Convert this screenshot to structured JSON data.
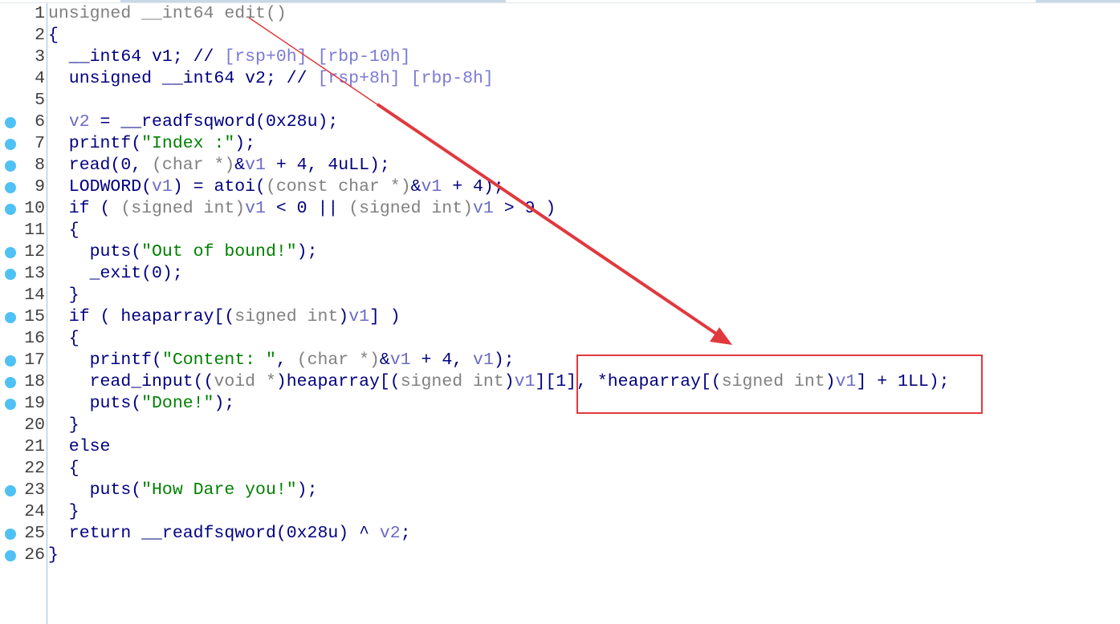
{
  "colors": {
    "code": "#000080",
    "type": "#808080",
    "variable": "#6b6bc4",
    "string": "#008000",
    "comment": "#7a7ad6",
    "breakpoint_dot": "#4fc1f5",
    "annotation": "#e0393e"
  },
  "lines": [
    {
      "n": "1",
      "dot": false,
      "tokens": [
        [
          "t",
          "unsigned __int64 edit()"
        ]
      ]
    },
    {
      "n": "2",
      "dot": false,
      "tokens": [
        [
          "k",
          "{"
        ]
      ]
    },
    {
      "n": "3",
      "dot": false,
      "tokens": [
        [
          "k",
          "  __int64 v1; // "
        ],
        [
          "c",
          "[rsp+0h] [rbp-10h]"
        ]
      ]
    },
    {
      "n": "4",
      "dot": false,
      "tokens": [
        [
          "k",
          "  unsigned __int64 v2; // "
        ],
        [
          "c",
          "[rsp+8h] [rbp-8h]"
        ]
      ]
    },
    {
      "n": "5",
      "dot": false,
      "tokens": []
    },
    {
      "n": "6",
      "dot": true,
      "tokens": [
        [
          "k",
          "  "
        ],
        [
          "v",
          "v2"
        ],
        [
          "k",
          " = __readfsqword(0x28u);"
        ]
      ]
    },
    {
      "n": "7",
      "dot": true,
      "tokens": [
        [
          "k",
          "  printf("
        ],
        [
          "s",
          "\"Index :\""
        ],
        [
          "k",
          ");"
        ]
      ]
    },
    {
      "n": "8",
      "dot": true,
      "tokens": [
        [
          "k",
          "  read(0, "
        ],
        [
          "t",
          "(char *)"
        ],
        [
          "k",
          "&"
        ],
        [
          "v",
          "v1"
        ],
        [
          "k",
          " + 4, 4uLL);"
        ]
      ]
    },
    {
      "n": "9",
      "dot": true,
      "tokens": [
        [
          "k",
          "  LODWORD("
        ],
        [
          "v",
          "v1"
        ],
        [
          "k",
          ") = atoi("
        ],
        [
          "t",
          "(const char *)"
        ],
        [
          "k",
          "&"
        ],
        [
          "v",
          "v1"
        ],
        [
          "k",
          " + 4);"
        ]
      ]
    },
    {
      "n": "10",
      "dot": true,
      "tokens": [
        [
          "k",
          "  if ( "
        ],
        [
          "t",
          "(signed int)"
        ],
        [
          "v",
          "v1"
        ],
        [
          "k",
          " < 0 || "
        ],
        [
          "t",
          "(signed int)"
        ],
        [
          "v",
          "v1"
        ],
        [
          "k",
          " > 9 )"
        ]
      ]
    },
    {
      "n": "11",
      "dot": false,
      "tokens": [
        [
          "k",
          "  {"
        ]
      ]
    },
    {
      "n": "12",
      "dot": true,
      "tokens": [
        [
          "k",
          "    puts("
        ],
        [
          "s",
          "\"Out of bound!\""
        ],
        [
          "k",
          ");"
        ]
      ]
    },
    {
      "n": "13",
      "dot": true,
      "tokens": [
        [
          "k",
          "    _exit(0);"
        ]
      ]
    },
    {
      "n": "14",
      "dot": false,
      "tokens": [
        [
          "k",
          "  }"
        ]
      ]
    },
    {
      "n": "15",
      "dot": true,
      "tokens": [
        [
          "k",
          "  if ( heaparray[("
        ],
        [
          "t",
          "signed int"
        ],
        [
          "k",
          ")"
        ],
        [
          "v",
          "v1"
        ],
        [
          "k",
          "] )"
        ]
      ]
    },
    {
      "n": "16",
      "dot": false,
      "tokens": [
        [
          "k",
          "  {"
        ]
      ]
    },
    {
      "n": "17",
      "dot": true,
      "tokens": [
        [
          "k",
          "    printf("
        ],
        [
          "s",
          "\"Content: \""
        ],
        [
          "k",
          ", "
        ],
        [
          "t",
          "(char *)"
        ],
        [
          "k",
          "&"
        ],
        [
          "v",
          "v1"
        ],
        [
          "k",
          " + 4, "
        ],
        [
          "v",
          "v1"
        ],
        [
          "k",
          ");"
        ]
      ]
    },
    {
      "n": "18",
      "dot": true,
      "tokens": [
        [
          "k",
          "    read_input(("
        ],
        [
          "t",
          "void *"
        ],
        [
          "k",
          ")heaparray[("
        ],
        [
          "t",
          "signed int"
        ],
        [
          "k",
          ")"
        ],
        [
          "v",
          "v1"
        ],
        [
          "k",
          "][1], *heaparray[("
        ],
        [
          "t",
          "signed int"
        ],
        [
          "k",
          ")"
        ],
        [
          "v",
          "v1"
        ],
        [
          "k",
          "] + 1LL);"
        ]
      ]
    },
    {
      "n": "19",
      "dot": true,
      "tokens": [
        [
          "k",
          "    puts("
        ],
        [
          "s",
          "\"Done!\""
        ],
        [
          "k",
          ");"
        ]
      ]
    },
    {
      "n": "20",
      "dot": false,
      "tokens": [
        [
          "k",
          "  }"
        ]
      ]
    },
    {
      "n": "21",
      "dot": false,
      "tokens": [
        [
          "k",
          "  else"
        ]
      ]
    },
    {
      "n": "22",
      "dot": false,
      "tokens": [
        [
          "k",
          "  {"
        ]
      ]
    },
    {
      "n": "23",
      "dot": true,
      "tokens": [
        [
          "k",
          "    puts("
        ],
        [
          "s",
          "\"How Dare you!\""
        ],
        [
          "k",
          ");"
        ]
      ]
    },
    {
      "n": "24",
      "dot": false,
      "tokens": [
        [
          "k",
          "  }"
        ]
      ]
    },
    {
      "n": "25",
      "dot": true,
      "tokens": [
        [
          "k",
          "  return __readfsqword(0x28u) ^ "
        ],
        [
          "v",
          "v2"
        ],
        [
          "k",
          ";"
        ]
      ]
    },
    {
      "n": "26",
      "dot": true,
      "tokens": [
        [
          "k",
          "}"
        ]
      ]
    }
  ]
}
